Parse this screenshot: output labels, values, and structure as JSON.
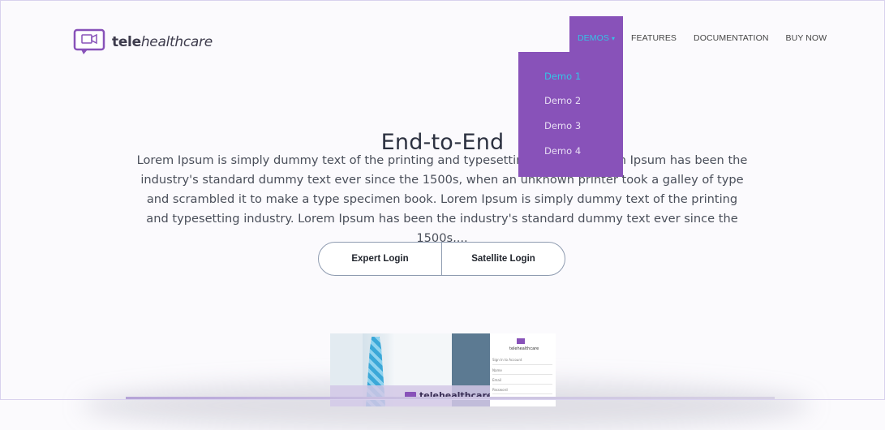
{
  "header": {
    "logo": {
      "text_bold": "tele",
      "text_light": "healthcare"
    },
    "nav": [
      {
        "label": "DEMOS",
        "key": "demos"
      },
      {
        "label": "FEATURES",
        "key": "features"
      },
      {
        "label": "DOCUMENTATION",
        "key": "docs"
      },
      {
        "label": "BUY NOW",
        "key": "buy"
      }
    ],
    "dropdown": [
      "Demo 1",
      "Demo 2",
      "Demo 3",
      "Demo 4"
    ]
  },
  "hero": {
    "title": "End-to-End",
    "text": "Lorem Ipsum is simply dummy text of the printing and typesetting industry. Lorem Ipsum has been the industry's standard dummy text ever since the 1500s, when an unknown printer took a galley of type and scrambled it to make a type specimen book. Lorem Ipsum is simply dummy text of the printing and typesetting industry. Lorem Ipsum has been the industry's standard dummy text ever since the 1500s,...",
    "buttons": {
      "expert": "Expert Login",
      "satellite": "Satellite Login"
    }
  },
  "preview": {
    "brand": "telehealthcare",
    "form_labels": [
      "Sign In to Account",
      "Name",
      "Email",
      "Password"
    ]
  },
  "colors": {
    "accent": "#8852b9",
    "highlight": "#35c3e6"
  },
  "icons": {
    "logo": "video-camera-chat-icon",
    "caret": "chevron-down-icon"
  }
}
